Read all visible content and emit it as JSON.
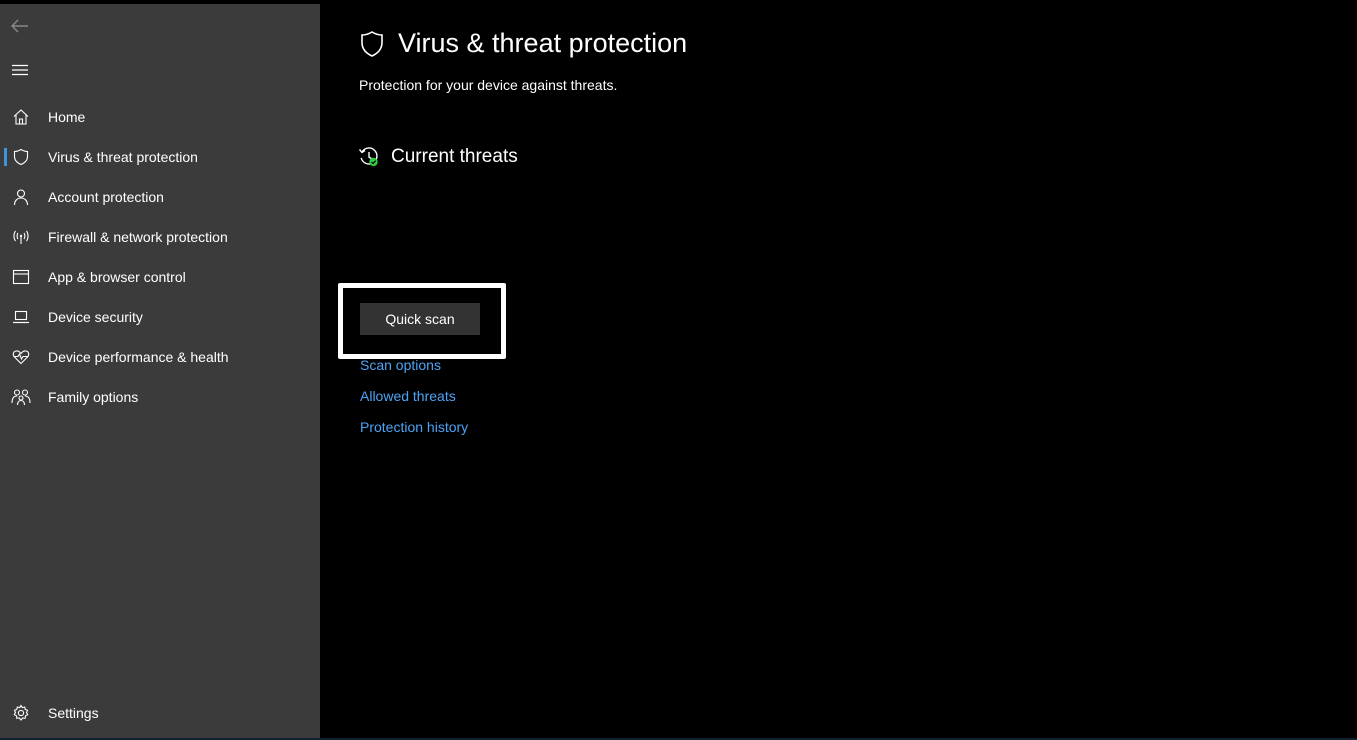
{
  "colors": {
    "sidebar_bg": "#3b3b3b",
    "main_bg": "#000000",
    "accent": "#3a96dd",
    "link": "#4ca3f5",
    "button_bg": "#333333",
    "status_green": "#2ecc40"
  },
  "sidebar": {
    "back_icon": "back-arrow-icon",
    "menu_icon": "hamburger-menu-icon",
    "items": [
      {
        "label": "Home",
        "icon": "home-icon",
        "active": false
      },
      {
        "label": "Virus & threat protection",
        "icon": "shield-icon",
        "active": true
      },
      {
        "label": "Account protection",
        "icon": "person-icon",
        "active": false
      },
      {
        "label": "Firewall & network protection",
        "icon": "antenna-icon",
        "active": false
      },
      {
        "label": "App & browser control",
        "icon": "browser-window-icon",
        "active": false
      },
      {
        "label": "Device security",
        "icon": "laptop-icon",
        "active": false
      },
      {
        "label": "Device performance & health",
        "icon": "heart-pulse-icon",
        "active": false
      },
      {
        "label": "Family options",
        "icon": "family-icon",
        "active": false
      }
    ],
    "settings": {
      "label": "Settings",
      "icon": "gear-icon"
    }
  },
  "main": {
    "title": "Virus & threat protection",
    "subtitle": "Protection for your device against threats.",
    "section_title": "Current threats",
    "quick_scan_label": "Quick scan",
    "links": [
      "Scan options",
      "Allowed threats",
      "Protection history"
    ]
  }
}
